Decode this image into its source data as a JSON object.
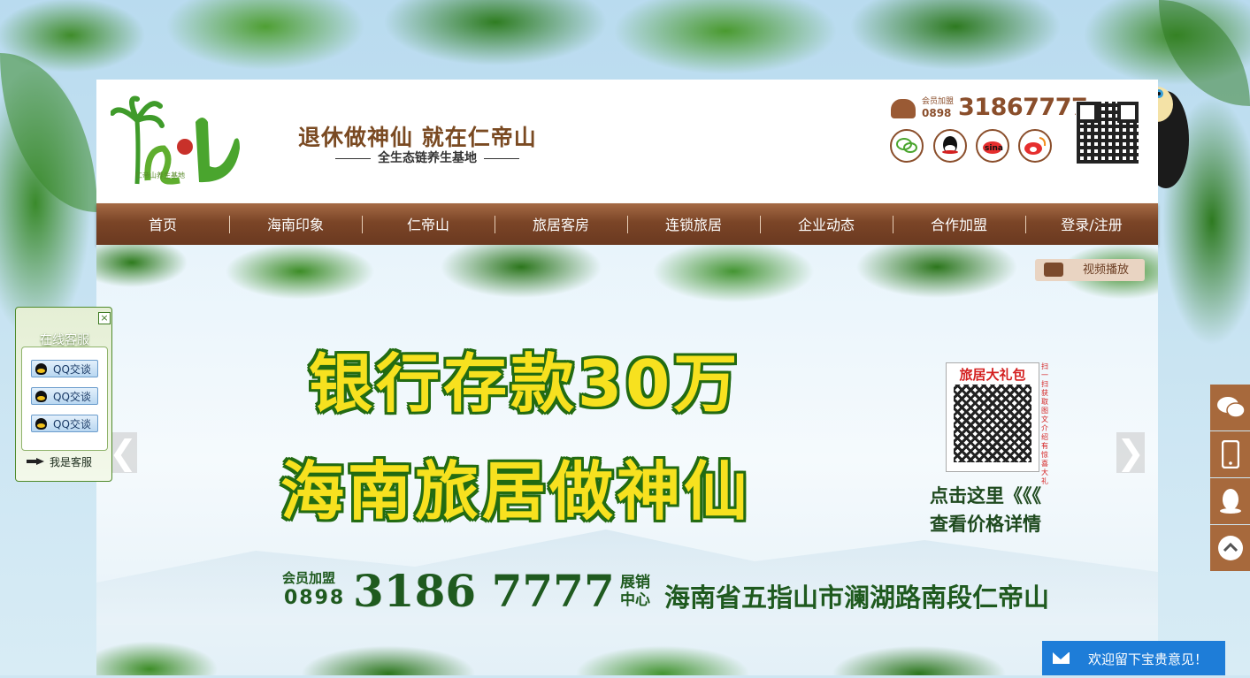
{
  "brand": {
    "logo_caption": "仁帝山养生基地",
    "slogan": "退休做神仙 就在仁帝山",
    "sub_slogan": "全生态链养生基地"
  },
  "contact": {
    "label": "会员加盟",
    "area_code": "0898",
    "number": "31867777"
  },
  "social_icons": [
    "wechat-icon",
    "qq-icon",
    "sina-icon",
    "weibo-icon"
  ],
  "nav": {
    "items": [
      {
        "label": "首页"
      },
      {
        "label": "海南印象"
      },
      {
        "label": "仁帝山"
      },
      {
        "label": "旅居客房"
      },
      {
        "label": "连锁旅居"
      },
      {
        "label": "企业动态"
      },
      {
        "label": "合作加盟"
      },
      {
        "label": "登录/注册"
      }
    ]
  },
  "banner": {
    "video_button": "视频播放",
    "headline_1": "银行存款30万",
    "headline_2": "海南旅居做神仙",
    "qr_title": "旅居大礼包",
    "qr_note": "扫一扫获取图文介绍有惊喜大礼",
    "click_line_1": "点击这里《《《",
    "click_line_2": "查看价格详情",
    "member_label": "会员加盟",
    "area_code": "0898",
    "phone": "3186 7777",
    "center_label": "展销中心",
    "address": "海南省五指山市澜湖路南段仁帝山",
    "prev_arrow": "❮",
    "next_arrow": "❯"
  },
  "customer_service": {
    "title": "在线客服",
    "close": "×",
    "buttons": [
      "QQ交谈",
      "QQ交谈",
      "QQ交谈"
    ],
    "self_label": "我是客服"
  },
  "sidebar": {
    "buttons": [
      "wechat-icon",
      "phone-icon",
      "qq-icon",
      "back-to-top-icon"
    ]
  },
  "feedback": {
    "label": "欢迎留下宝贵意见！"
  },
  "colors": {
    "nav_brown": "#7b4527",
    "accent_brown": "#a7693c",
    "headline_yellow": "#f7e11f",
    "headline_green": "#226b12",
    "feedback_blue": "#1e7dd8"
  }
}
